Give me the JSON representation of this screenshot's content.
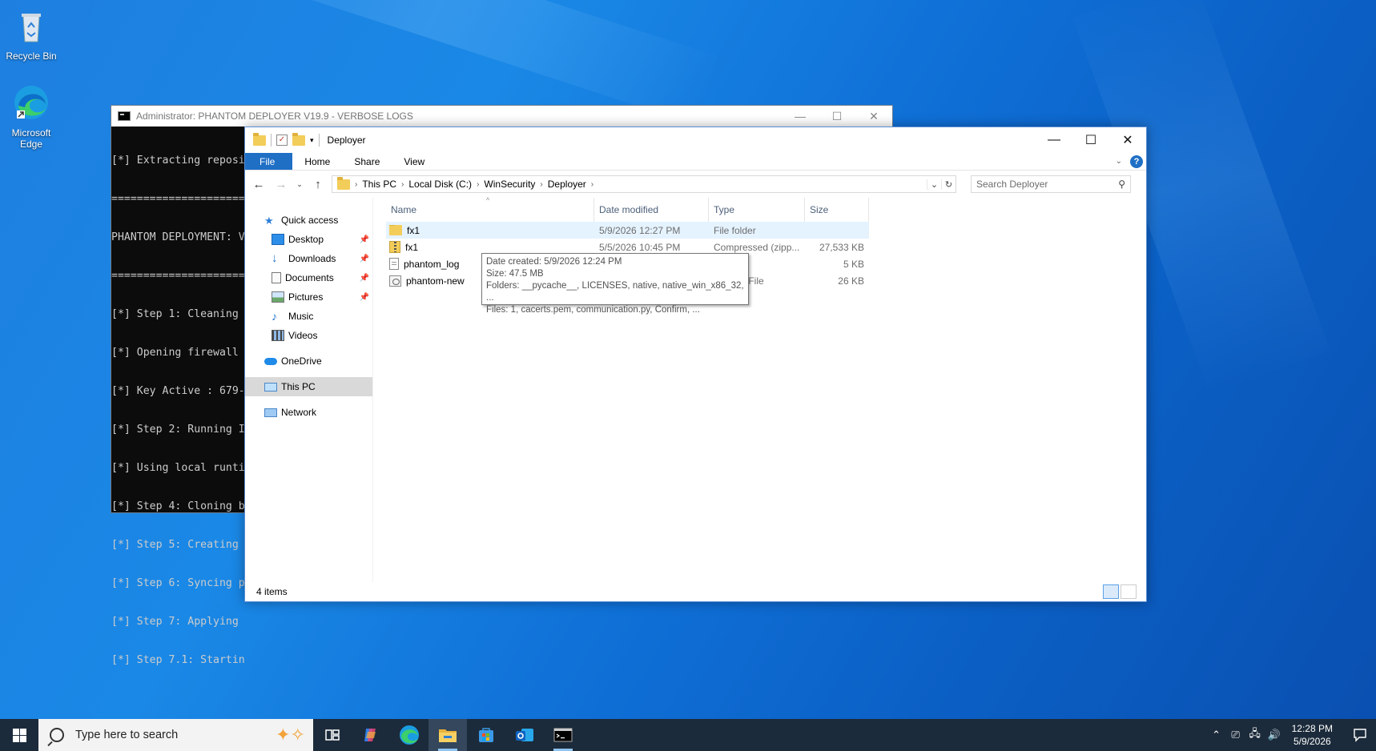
{
  "desktop": {
    "icons": [
      {
        "label": "Recycle Bin",
        "icon": "recycle-bin-icon"
      },
      {
        "label": "Microsoft\nEdge",
        "icon": "edge-icon"
      }
    ]
  },
  "console": {
    "title": "Administrator:  PHANTOM DEPLOYER V19.9 - VERBOSE LOGS",
    "lines": [
      "[*] Extracting reposi",
      "========================",
      "PHANTOM DEPLOYMENT: V",
      "========================",
      "[*] Step 1: Cleaning",
      "[*] Opening firewall",
      "[*] Key Active : 679-",
      "[*] Step 2: Running I",
      "[*] Using local runti",
      "[*] Step 4: Cloning b",
      "[*] Step 5: Creating",
      "[*] Step 6: Syncing p",
      "[*] Step 7: Applying",
      "[*] Step 7.1: Startin"
    ]
  },
  "explorer": {
    "title": "Deployer",
    "ribbon": {
      "file": "File",
      "home": "Home",
      "share": "Share",
      "view": "View"
    },
    "path": [
      "This PC",
      "Local Disk (C:)",
      "WinSecurity",
      "Deployer"
    ],
    "search_placeholder": "Search Deployer",
    "nav": {
      "quick_access": "Quick access",
      "desktop": "Desktop",
      "downloads": "Downloads",
      "documents": "Documents",
      "pictures": "Pictures",
      "music": "Music",
      "videos": "Videos",
      "onedrive": "OneDrive",
      "this_pc": "This PC",
      "network": "Network"
    },
    "columns": {
      "name": "Name",
      "date": "Date modified",
      "type": "Type",
      "size": "Size"
    },
    "files": [
      {
        "name": "fx1",
        "date": "5/9/2026 12:27 PM",
        "type": "File folder",
        "size": "",
        "icon": "folder-icon"
      },
      {
        "name": "fx1",
        "date": "5/5/2026 10:45 PM",
        "type": "Compressed (zipp...",
        "size": "27,533 KB",
        "icon": "zip-folder-icon"
      },
      {
        "name": "phantom_log",
        "date": "",
        "type": "ument",
        "size": "5 KB",
        "icon": "text-document-icon"
      },
      {
        "name": "phantom-new",
        "date": "",
        "type": "s Batch File",
        "size": "26 KB",
        "icon": "batch-file-icon"
      }
    ],
    "tooltip": {
      "line1": "Date created: 5/9/2026 12:24 PM",
      "line2": "Size: 47.5 MB",
      "line3": "Folders: __pycache__, LICENSES, native, native_win_x86_32, ...",
      "line4": "Files: 1, cacerts.pem, communication.py, Confirm, ..."
    },
    "status": "4 items"
  },
  "taskbar": {
    "search_placeholder": "Type here to search",
    "time": "12:28 PM",
    "date": "5/9/2026"
  },
  "colors": {
    "accent": "#1f6fc5",
    "taskbar": "#1c2b3b",
    "console_bg": "#0c0c0c"
  }
}
